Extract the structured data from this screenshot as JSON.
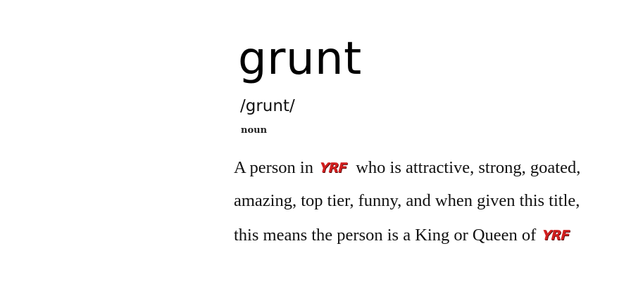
{
  "entry": {
    "word": "grunt",
    "pronunciation": "/grunt/",
    "part_of_speech": "noun",
    "definition": {
      "line1_before_logo": "A person in",
      "logo_text": "YRF",
      "line1_after_logo": "who is attractive, strong, goated,",
      "line2": "amazing, top tier, funny, and when given this title,",
      "line3_before_logo": "this means the person is a King or Queen of"
    }
  },
  "colors": {
    "text": "#111111",
    "logo_red": "#d21f1f",
    "logo_dark": "#5a0c0c"
  }
}
